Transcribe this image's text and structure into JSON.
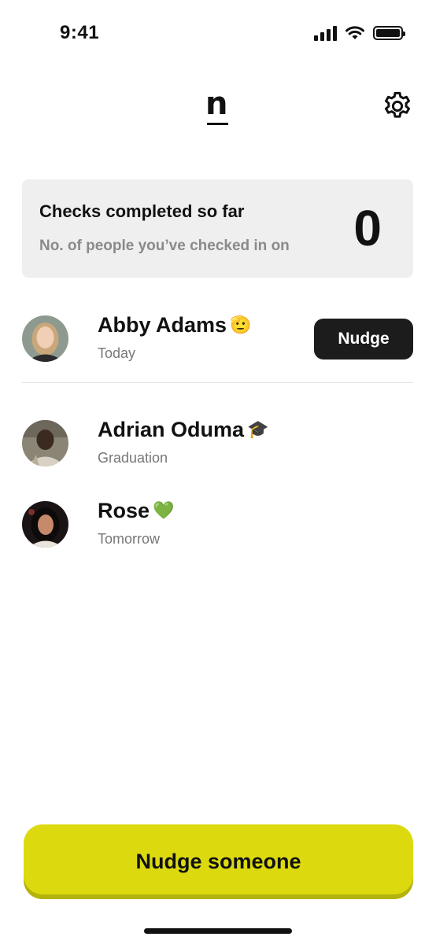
{
  "status_bar": {
    "time": "9:41"
  },
  "header": {
    "logo": "n",
    "settings_icon": "gear-icon"
  },
  "summary": {
    "title": "Checks completed so far",
    "subtitle": "No. of people you’ve checked in on",
    "count": "0"
  },
  "people": [
    {
      "name": "Abby Adams",
      "emoji": "🫡",
      "subtitle": "Today",
      "action": "Nudge"
    },
    {
      "name": "Adrian Oduma",
      "emoji": "🎓",
      "subtitle": "Graduation"
    },
    {
      "name": "Rose",
      "emoji": "💚",
      "subtitle": "Tomorrow"
    }
  ],
  "cta": {
    "label": "Nudge someone"
  },
  "colors": {
    "accent": "#dcda0f",
    "card_bg": "#efefef",
    "button_dark": "#1c1c1c",
    "muted_text": "#8a8a8a"
  }
}
